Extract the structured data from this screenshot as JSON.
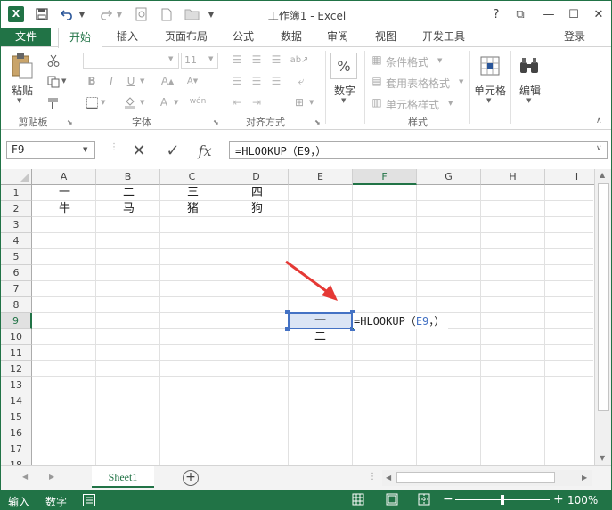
{
  "titlebar": {
    "title": "工作簿1 - Excel",
    "help": "?",
    "restore": "⧉",
    "minimize": "—",
    "maximize": "☐",
    "close": "✕"
  },
  "tabs": [
    "文件",
    "开始",
    "插入",
    "页面布局",
    "公式",
    "数据",
    "审阅",
    "视图",
    "开发工具"
  ],
  "signin": "登录",
  "ribbon": {
    "clipboard": {
      "paste": "粘贴",
      "label": "剪贴板"
    },
    "font": {
      "size": "11",
      "label": "字体"
    },
    "alignment": {
      "label": "对齐方式"
    },
    "number": {
      "btn": "数字",
      "pct": "%"
    },
    "styles": {
      "cond": "条件格式",
      "table": "套用表格格式",
      "cell": "单元格样式",
      "label": "样式"
    },
    "cells": {
      "btn": "单元格"
    },
    "editing": {
      "btn": "编辑"
    }
  },
  "namebox": "F9",
  "formula": "=HLOOKUP（E9，）",
  "columns": [
    "A",
    "B",
    "C",
    "D",
    "E",
    "F",
    "G",
    "H",
    "I"
  ],
  "selected_col": "F",
  "rows": [
    "1",
    "2",
    "3",
    "4",
    "5",
    "6",
    "7",
    "8",
    "9",
    "10",
    "11",
    "12",
    "13",
    "14",
    "15",
    "16",
    "17",
    "18"
  ],
  "selected_row": "9",
  "cells": {
    "A1": "一",
    "B1": "二",
    "C1": "三",
    "D1": "四",
    "A2": "牛",
    "B2": "马",
    "C2": "猪",
    "D2": "狗",
    "E9": "一",
    "E10": "二"
  },
  "editing_cell": {
    "prefix": "=HLOOKUP（",
    "ref": "E9",
    "suffix": "，）"
  },
  "sheet_tab": "Sheet1",
  "status": {
    "mode": "输入",
    "numlock": "数字",
    "zoom": "100%"
  },
  "colors": {
    "accent": "#217346",
    "ref_blue": "#4472c4",
    "arrow": "#e53935"
  }
}
